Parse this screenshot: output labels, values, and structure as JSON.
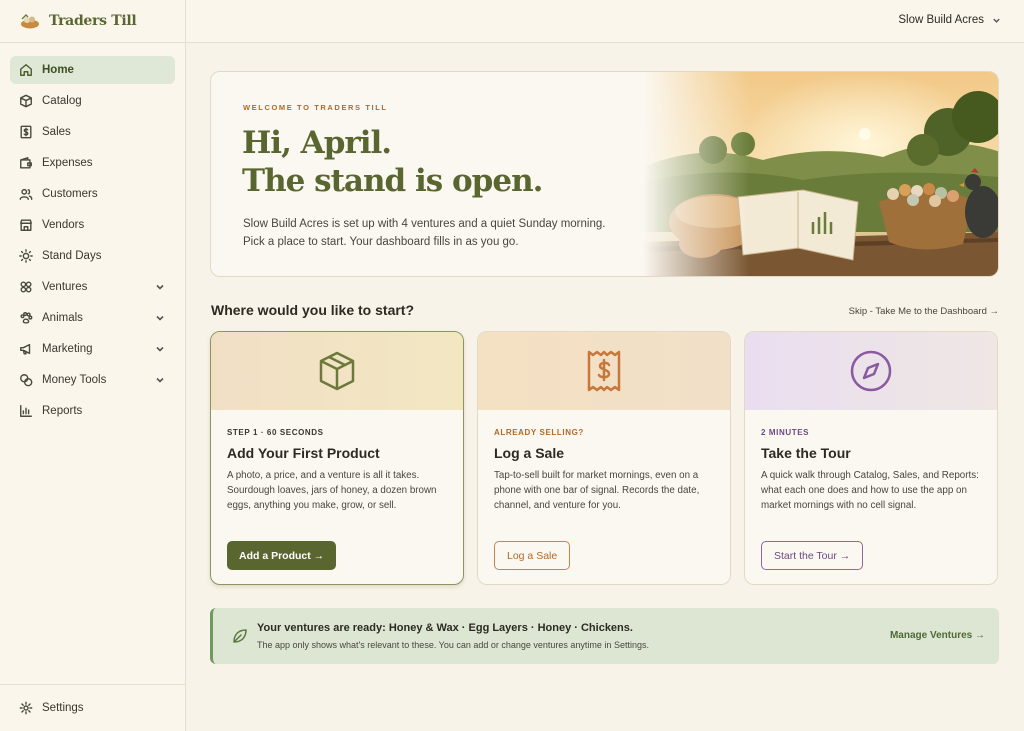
{
  "brand": {
    "name": "Traders Till"
  },
  "sidebar": {
    "items": [
      {
        "label": "Home",
        "icon": "home-icon",
        "active": true
      },
      {
        "label": "Catalog",
        "icon": "box-icon"
      },
      {
        "label": "Sales",
        "icon": "dollar-icon"
      },
      {
        "label": "Expenses",
        "icon": "wallet-icon"
      },
      {
        "label": "Customers",
        "icon": "users-icon"
      },
      {
        "label": "Vendors",
        "icon": "store-icon"
      },
      {
        "label": "Stand Days",
        "icon": "sun-icon"
      },
      {
        "label": "Ventures",
        "icon": "ventures-icon",
        "expandable": true
      },
      {
        "label": "Animals",
        "icon": "paw-icon",
        "expandable": true
      },
      {
        "label": "Marketing",
        "icon": "megaphone-icon",
        "expandable": true
      },
      {
        "label": "Money Tools",
        "icon": "coins-icon",
        "expandable": true
      },
      {
        "label": "Reports",
        "icon": "bar-chart-icon"
      }
    ],
    "settings_label": "Settings"
  },
  "topbar": {
    "account_name": "Slow Build Acres"
  },
  "hero": {
    "eyebrow": "WELCOME TO TRADERS TILL",
    "title_line1": "Hi, April.",
    "title_line2": "The stand is open.",
    "body": "Slow Build Acres is set up with 4 ventures and a quiet Sunday morning. Pick a place to start. Your dashboard fills in as you go."
  },
  "start": {
    "title": "Where would you like to start?",
    "skip": "Skip - Take Me to the Dashboard →"
  },
  "cards": [
    {
      "step": "STEP 1 · 60 SECONDS",
      "title": "Add Your First Product",
      "desc": "A photo, a price, and a venture is all it takes. Sourdough loaves, jars of honey, a dozen brown eggs, anything you make, grow, or sell.",
      "button": "Add a Product →",
      "icon": "box-icon"
    },
    {
      "step": "ALREADY SELLING?",
      "title": "Log a Sale",
      "desc": "Tap-to-sell built for market mornings, even on a phone with one bar of signal. Records the date, channel, and venture for you.",
      "button": "Log a Sale",
      "icon": "receipt-dollar-icon"
    },
    {
      "step": "2 MINUTES",
      "title": "Take the Tour",
      "desc": "A quick walk through Catalog, Sales, and Reports: what each one does and how to use the app on market mornings with no cell signal.",
      "button": "Start the Tour →",
      "icon": "compass-icon"
    }
  ],
  "banner": {
    "title": "Your ventures are ready: Honey & Wax · Egg Layers · Honey · Chickens.",
    "sub": "The app only shows what's relevant to these. You can add or change ventures anytime in Settings.",
    "link": "Manage Ventures →"
  },
  "colors": {
    "accent_olive": "#5a6630",
    "accent_orange": "#b06a2a",
    "accent_purple": "#6a4a80",
    "banner_green": "#dde6d3",
    "background": "#f8f3e8"
  }
}
